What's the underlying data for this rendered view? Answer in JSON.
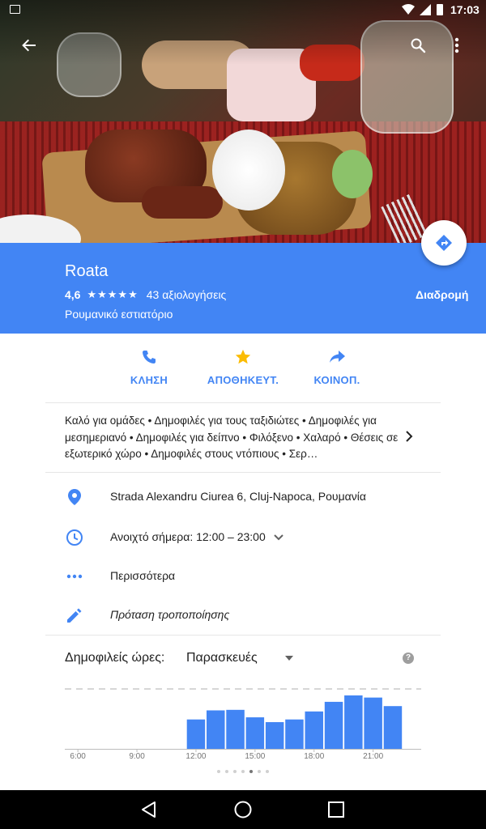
{
  "status_bar": {
    "time": "17:03"
  },
  "place": {
    "name": "Roata",
    "rating": "4,6",
    "stars": "★★★★★",
    "reviews": "43 αξιολογήσεις",
    "category": "Ρουμανικό εστιατόριο",
    "directions_label": "Διαδρομή"
  },
  "actions": [
    {
      "label": "ΚΛΗΣΗ",
      "icon": "phone-icon"
    },
    {
      "label": "ΑΠΟΘΗΚΕΥΤ.",
      "icon": "star-icon"
    },
    {
      "label": "ΚΟΙΝΟΠ.",
      "icon": "share-icon"
    }
  ],
  "highlights": "Καλό για ομάδες • Δημοφιλές για τους ταξιδιώτες • Δημοφιλές για μεσημεριανό • Δημοφιλές για δείπνο • Φιλόξενο • Χαλαρό • Θέσεις σε εξωτερικό χώρο • Δημοφιλές στους ντόπιους • Σερ…",
  "info": {
    "address": "Strada Alexandru Ciurea 6, Cluj-Napoca, Ρουμανία",
    "hours": "Ανοιχτό σήμερα: 12:00 – 23:00",
    "more": "Περισσότερα",
    "suggest_edit": "Πρόταση τροποποίησης"
  },
  "popular_times": {
    "title": "Δημοφιλείς ώρες:",
    "day": "Παρασκευές"
  },
  "colors": {
    "accent": "#4285f4",
    "star": "#fbbc04"
  },
  "chart_data": {
    "type": "bar",
    "categories": [
      "6:00",
      "7:00",
      "8:00",
      "9:00",
      "10:00",
      "11:00",
      "12:00",
      "13:00",
      "14:00",
      "15:00",
      "16:00",
      "17:00",
      "18:00",
      "19:00",
      "20:00",
      "21:00",
      "22:00",
      "23:00"
    ],
    "values": [
      0,
      0,
      0,
      0,
      0,
      0,
      55,
      72,
      73,
      59,
      50,
      55,
      70,
      88,
      100,
      96,
      80,
      0
    ],
    "tick_labels": [
      "6:00",
      "9:00",
      "12:00",
      "15:00",
      "18:00",
      "21:00"
    ],
    "tick_categories": [
      "6:00",
      "9:00",
      "12:00",
      "15:00",
      "18:00",
      "21:00"
    ],
    "ylim": [
      0,
      100
    ],
    "xlabel": "",
    "ylabel": "",
    "title": ""
  }
}
